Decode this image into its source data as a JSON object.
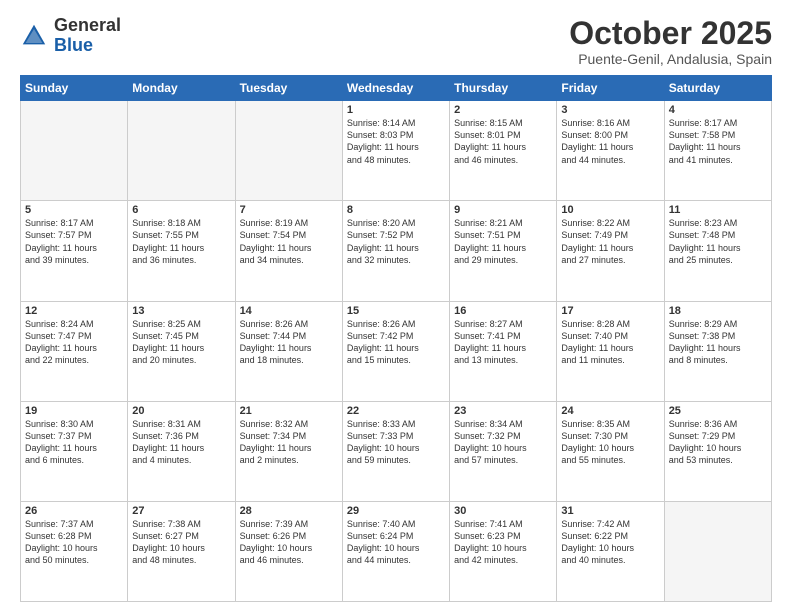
{
  "header": {
    "logo_general": "General",
    "logo_blue": "Blue",
    "month": "October 2025",
    "location": "Puente-Genil, Andalusia, Spain"
  },
  "weekdays": [
    "Sunday",
    "Monday",
    "Tuesday",
    "Wednesday",
    "Thursday",
    "Friday",
    "Saturday"
  ],
  "weeks": [
    [
      {
        "day": "",
        "info": ""
      },
      {
        "day": "",
        "info": ""
      },
      {
        "day": "",
        "info": ""
      },
      {
        "day": "1",
        "info": "Sunrise: 8:14 AM\nSunset: 8:03 PM\nDaylight: 11 hours\nand 48 minutes."
      },
      {
        "day": "2",
        "info": "Sunrise: 8:15 AM\nSunset: 8:01 PM\nDaylight: 11 hours\nand 46 minutes."
      },
      {
        "day": "3",
        "info": "Sunrise: 8:16 AM\nSunset: 8:00 PM\nDaylight: 11 hours\nand 44 minutes."
      },
      {
        "day": "4",
        "info": "Sunrise: 8:17 AM\nSunset: 7:58 PM\nDaylight: 11 hours\nand 41 minutes."
      }
    ],
    [
      {
        "day": "5",
        "info": "Sunrise: 8:17 AM\nSunset: 7:57 PM\nDaylight: 11 hours\nand 39 minutes."
      },
      {
        "day": "6",
        "info": "Sunrise: 8:18 AM\nSunset: 7:55 PM\nDaylight: 11 hours\nand 36 minutes."
      },
      {
        "day": "7",
        "info": "Sunrise: 8:19 AM\nSunset: 7:54 PM\nDaylight: 11 hours\nand 34 minutes."
      },
      {
        "day": "8",
        "info": "Sunrise: 8:20 AM\nSunset: 7:52 PM\nDaylight: 11 hours\nand 32 minutes."
      },
      {
        "day": "9",
        "info": "Sunrise: 8:21 AM\nSunset: 7:51 PM\nDaylight: 11 hours\nand 29 minutes."
      },
      {
        "day": "10",
        "info": "Sunrise: 8:22 AM\nSunset: 7:49 PM\nDaylight: 11 hours\nand 27 minutes."
      },
      {
        "day": "11",
        "info": "Sunrise: 8:23 AM\nSunset: 7:48 PM\nDaylight: 11 hours\nand 25 minutes."
      }
    ],
    [
      {
        "day": "12",
        "info": "Sunrise: 8:24 AM\nSunset: 7:47 PM\nDaylight: 11 hours\nand 22 minutes."
      },
      {
        "day": "13",
        "info": "Sunrise: 8:25 AM\nSunset: 7:45 PM\nDaylight: 11 hours\nand 20 minutes."
      },
      {
        "day": "14",
        "info": "Sunrise: 8:26 AM\nSunset: 7:44 PM\nDaylight: 11 hours\nand 18 minutes."
      },
      {
        "day": "15",
        "info": "Sunrise: 8:26 AM\nSunset: 7:42 PM\nDaylight: 11 hours\nand 15 minutes."
      },
      {
        "day": "16",
        "info": "Sunrise: 8:27 AM\nSunset: 7:41 PM\nDaylight: 11 hours\nand 13 minutes."
      },
      {
        "day": "17",
        "info": "Sunrise: 8:28 AM\nSunset: 7:40 PM\nDaylight: 11 hours\nand 11 minutes."
      },
      {
        "day": "18",
        "info": "Sunrise: 8:29 AM\nSunset: 7:38 PM\nDaylight: 11 hours\nand 8 minutes."
      }
    ],
    [
      {
        "day": "19",
        "info": "Sunrise: 8:30 AM\nSunset: 7:37 PM\nDaylight: 11 hours\nand 6 minutes."
      },
      {
        "day": "20",
        "info": "Sunrise: 8:31 AM\nSunset: 7:36 PM\nDaylight: 11 hours\nand 4 minutes."
      },
      {
        "day": "21",
        "info": "Sunrise: 8:32 AM\nSunset: 7:34 PM\nDaylight: 11 hours\nand 2 minutes."
      },
      {
        "day": "22",
        "info": "Sunrise: 8:33 AM\nSunset: 7:33 PM\nDaylight: 10 hours\nand 59 minutes."
      },
      {
        "day": "23",
        "info": "Sunrise: 8:34 AM\nSunset: 7:32 PM\nDaylight: 10 hours\nand 57 minutes."
      },
      {
        "day": "24",
        "info": "Sunrise: 8:35 AM\nSunset: 7:30 PM\nDaylight: 10 hours\nand 55 minutes."
      },
      {
        "day": "25",
        "info": "Sunrise: 8:36 AM\nSunset: 7:29 PM\nDaylight: 10 hours\nand 53 minutes."
      }
    ],
    [
      {
        "day": "26",
        "info": "Sunrise: 7:37 AM\nSunset: 6:28 PM\nDaylight: 10 hours\nand 50 minutes."
      },
      {
        "day": "27",
        "info": "Sunrise: 7:38 AM\nSunset: 6:27 PM\nDaylight: 10 hours\nand 48 minutes."
      },
      {
        "day": "28",
        "info": "Sunrise: 7:39 AM\nSunset: 6:26 PM\nDaylight: 10 hours\nand 46 minutes."
      },
      {
        "day": "29",
        "info": "Sunrise: 7:40 AM\nSunset: 6:24 PM\nDaylight: 10 hours\nand 44 minutes."
      },
      {
        "day": "30",
        "info": "Sunrise: 7:41 AM\nSunset: 6:23 PM\nDaylight: 10 hours\nand 42 minutes."
      },
      {
        "day": "31",
        "info": "Sunrise: 7:42 AM\nSunset: 6:22 PM\nDaylight: 10 hours\nand 40 minutes."
      },
      {
        "day": "",
        "info": ""
      }
    ]
  ]
}
